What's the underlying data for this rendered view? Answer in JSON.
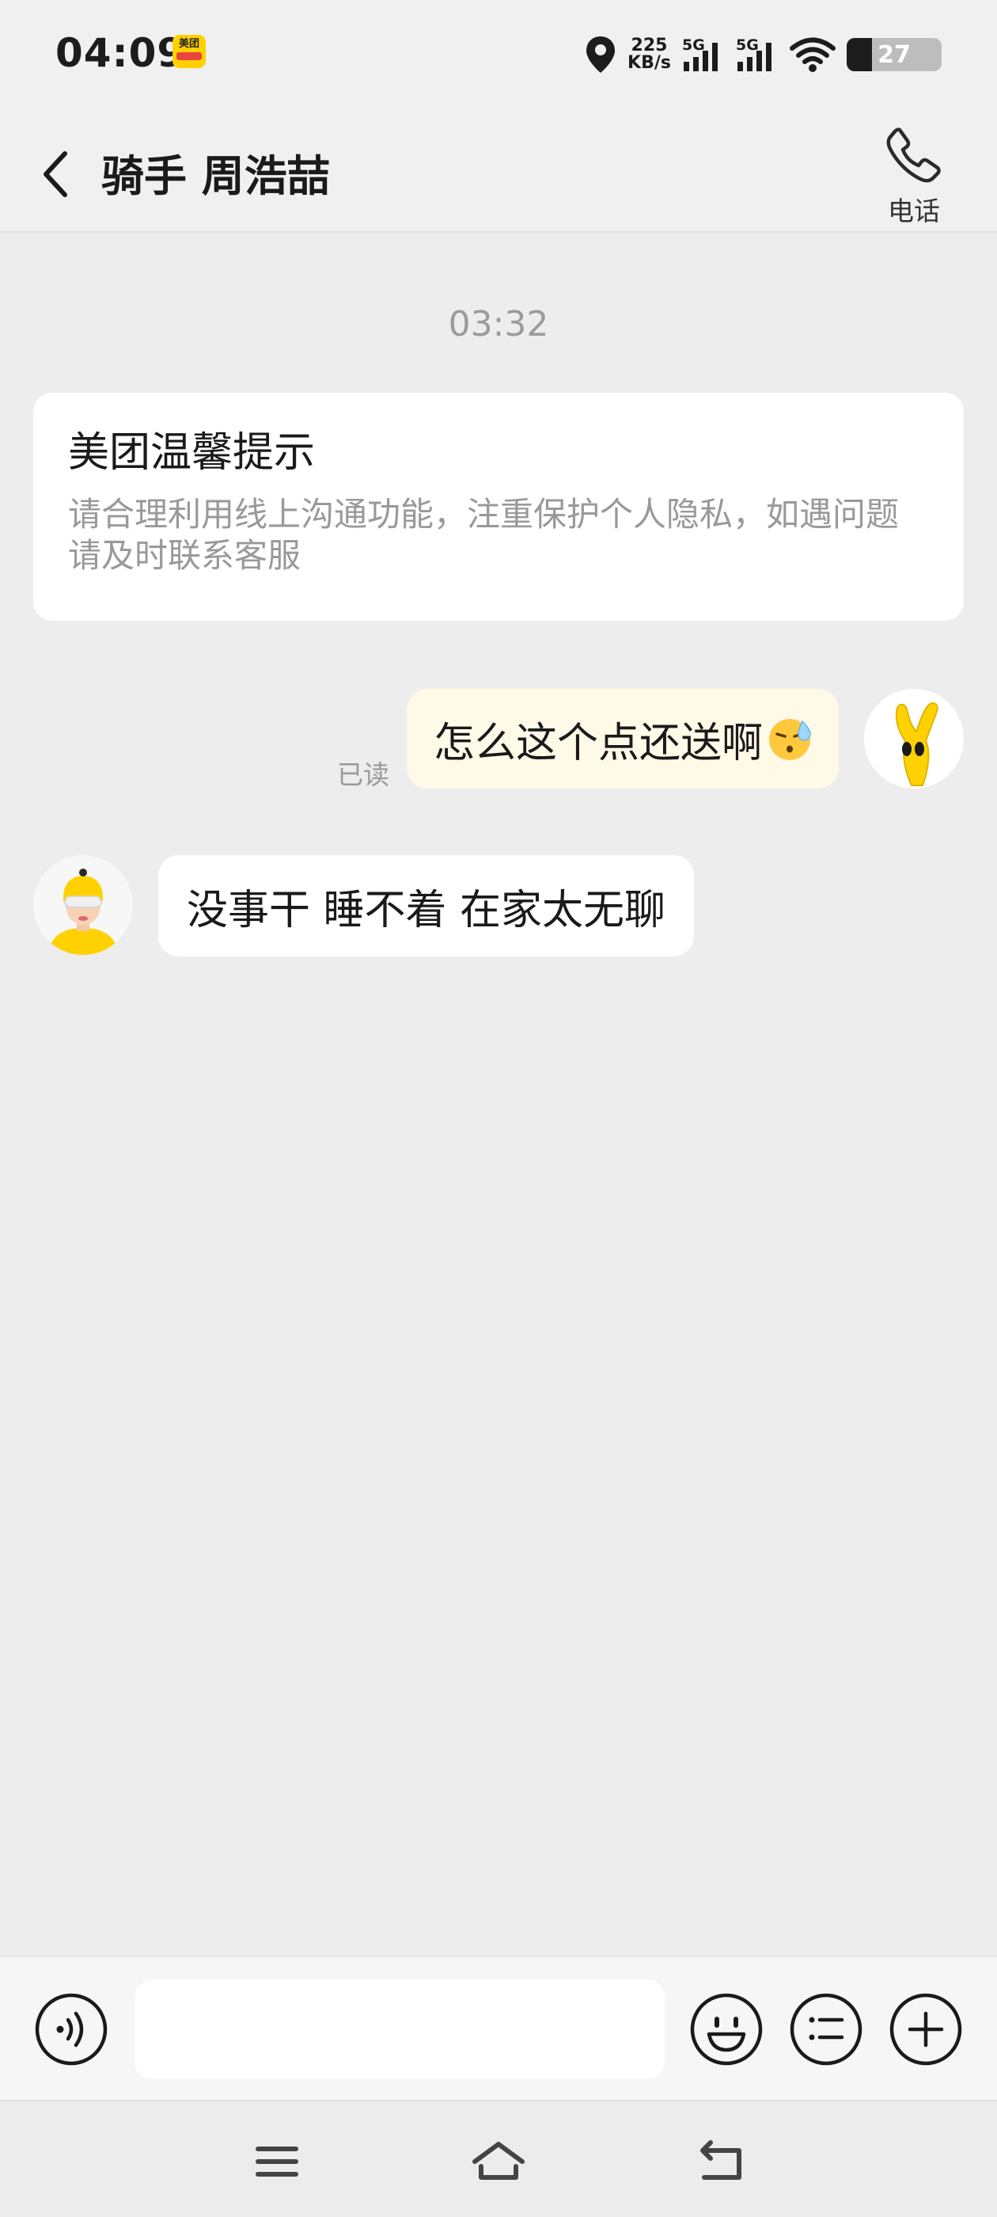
{
  "status_bar": {
    "time": "04:09",
    "app_icon_text": "美团",
    "net_speed_value": "225",
    "net_speed_unit": "KB/s",
    "sim1_label": "5G",
    "sim2_label": "5G",
    "battery_level": "27",
    "battery_fraction": 0.27
  },
  "header": {
    "title": "骑手 周浩喆",
    "phone_label": "电话"
  },
  "chat": {
    "timestamp": "03:32",
    "notice": {
      "title": "美团温馨提示",
      "body": "请合理利用线上沟通功能，注重保护个人隐私，如遇问题请及时联系客服"
    },
    "outgoing_message": "怎么这个点还送啊",
    "outgoing_emoji": "sweat-face-emoji",
    "read_status": "已读",
    "incoming_message": "没事干 睡不着 在家太无聊"
  },
  "input_bar": {
    "placeholder": "",
    "icons": [
      "voice-icon",
      "emoji-icon",
      "quick-phrase-icon",
      "plus-icon"
    ]
  },
  "nav_bar": {
    "icons": [
      "menu-icon",
      "home-icon",
      "back-icon"
    ]
  },
  "colors": {
    "page_bg": "#ededed",
    "outgoing_bubble": "#fff9e8",
    "incoming_bubble": "#ffffff",
    "brand_yellow": "#ffd100"
  }
}
